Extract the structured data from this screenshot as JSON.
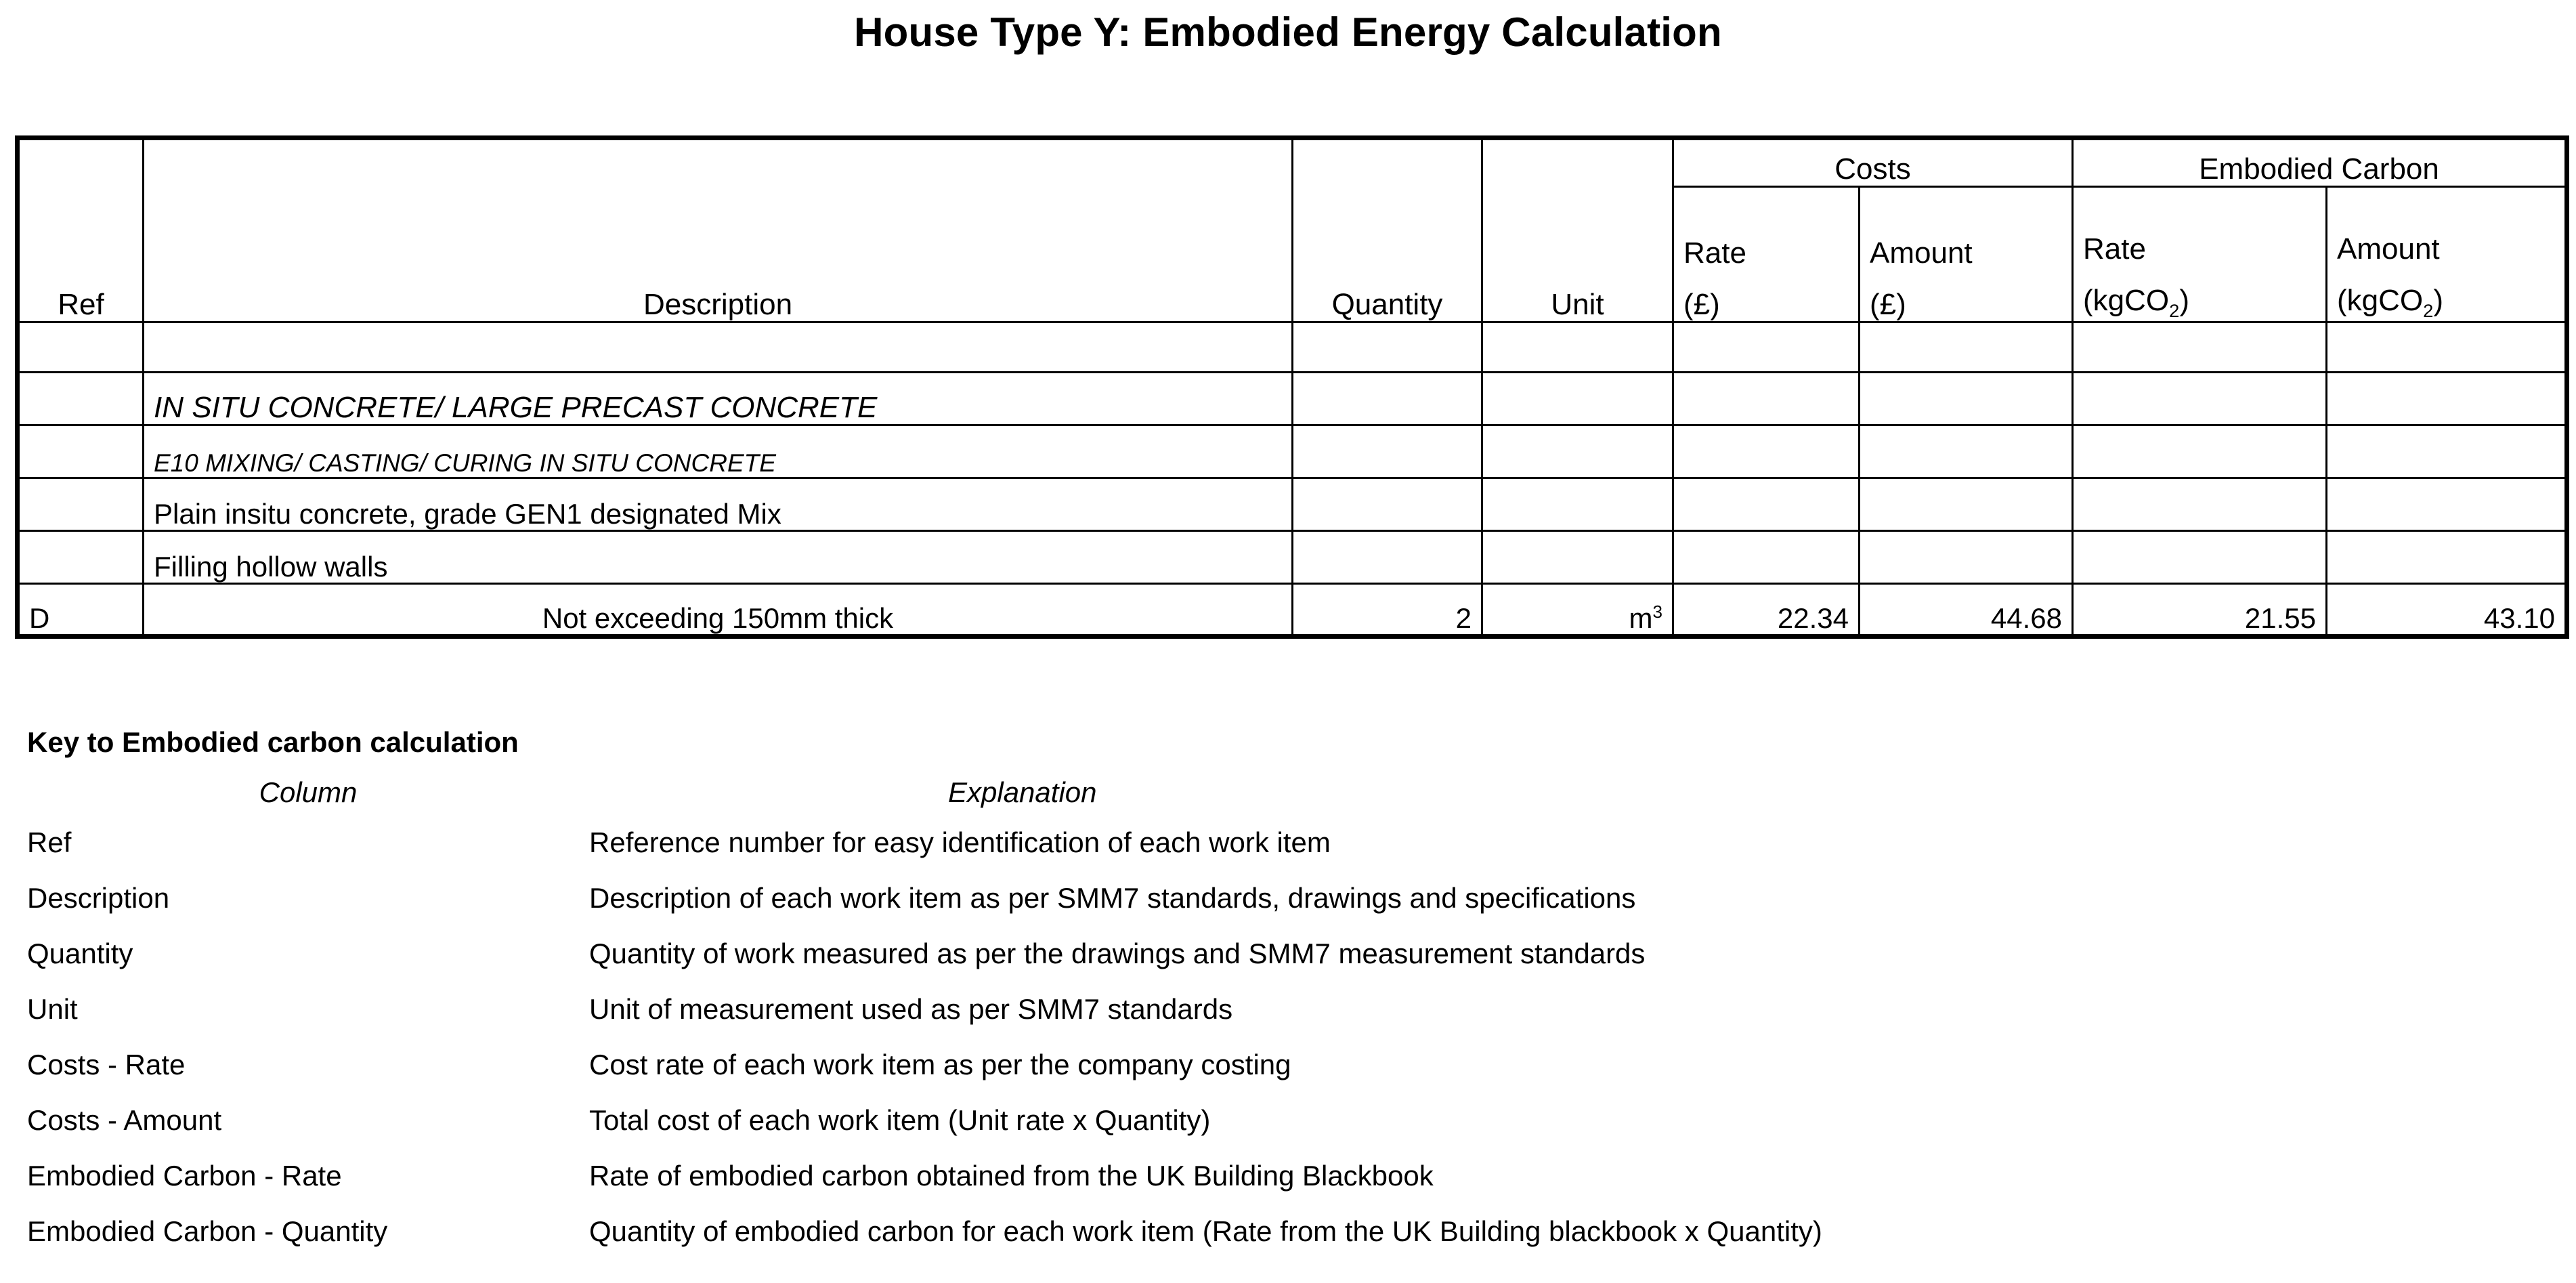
{
  "title": "House Type Y: Embodied Energy Calculation",
  "table": {
    "group_headers": {
      "costs": "Costs",
      "embodied_carbon": "Embodied Carbon"
    },
    "headers": {
      "ref": "Ref",
      "description": "Description",
      "quantity": "Quantity",
      "unit": "Unit",
      "cost_rate_l1": "Rate",
      "cost_rate_l2": "(£)",
      "cost_amount_l1": "Amount",
      "cost_amount_l2": "(£)",
      "carbon_rate_l1": "Rate",
      "carbon_rate_l2_pre": "(kgCO",
      "carbon_rate_l2_sub": "2",
      "carbon_rate_l2_post": ")",
      "carbon_amount_l1": "Amount",
      "carbon_amount_l2_pre": "(kgCO",
      "carbon_amount_l2_sub": "2",
      "carbon_amount_l2_post": ")"
    },
    "rows": [
      {
        "style": "blank",
        "ref": "",
        "description": "",
        "quantity": "",
        "unit": "",
        "cost_rate": "",
        "cost_amount": "",
        "carbon_rate": "",
        "carbon_amount": ""
      },
      {
        "style": "section",
        "ref": "",
        "description": "IN SITU CONCRETE/ LARGE PRECAST CONCRETE",
        "quantity": "",
        "unit": "",
        "cost_rate": "",
        "cost_amount": "",
        "carbon_rate": "",
        "carbon_amount": ""
      },
      {
        "style": "subsection",
        "ref": "",
        "description": "E10 MIXING/ CASTING/ CURING IN SITU CONCRETE",
        "quantity": "",
        "unit": "",
        "cost_rate": "",
        "cost_amount": "",
        "carbon_rate": "",
        "carbon_amount": ""
      },
      {
        "style": "item",
        "ref": "",
        "description": "Plain insitu concrete, grade GEN1 designated Mix",
        "quantity": "",
        "unit": "",
        "cost_rate": "",
        "cost_amount": "",
        "carbon_rate": "",
        "carbon_amount": ""
      },
      {
        "style": "item",
        "ref": "",
        "description": "Filling hollow walls",
        "quantity": "",
        "unit": "",
        "cost_rate": "",
        "cost_amount": "",
        "carbon_rate": "",
        "carbon_amount": ""
      },
      {
        "style": "data",
        "ref": "D",
        "description": "Not exceeding 150mm thick",
        "quantity": "2",
        "unit_base": "m",
        "unit_sup": "3",
        "cost_rate": "22.34",
        "cost_amount": "44.68",
        "carbon_rate": "21.55",
        "carbon_amount": "43.10"
      }
    ]
  },
  "key": {
    "title": "Key to Embodied carbon calculation",
    "header_column": "Column",
    "header_explanation": "Explanation",
    "rows": [
      {
        "column": "Ref",
        "explanation": "Reference number for easy identification of each work item"
      },
      {
        "column": "Description",
        "explanation": "Description of each work item as per SMM7 standards, drawings and specifications"
      },
      {
        "column": "Quantity",
        "explanation": "Quantity of work measured as per the drawings and SMM7 measurement standards"
      },
      {
        "column": "Unit",
        "explanation": "Unit of measurement used as per SMM7 standards"
      },
      {
        "column": "Costs - Rate",
        "explanation": "Cost rate of each work item as per the company costing"
      },
      {
        "column": "Costs - Amount",
        "explanation": "Total cost of each work item (Unit rate x Quantity)"
      },
      {
        "column": "Embodied Carbon - Rate",
        "explanation": "Rate of embodied carbon obtained from the UK Building Blackbook"
      },
      {
        "column": "Embodied Carbon - Quantity",
        "explanation": "Quantity of embodied carbon for each work item (Rate from the UK Building blackbook x Quantity)"
      }
    ]
  }
}
